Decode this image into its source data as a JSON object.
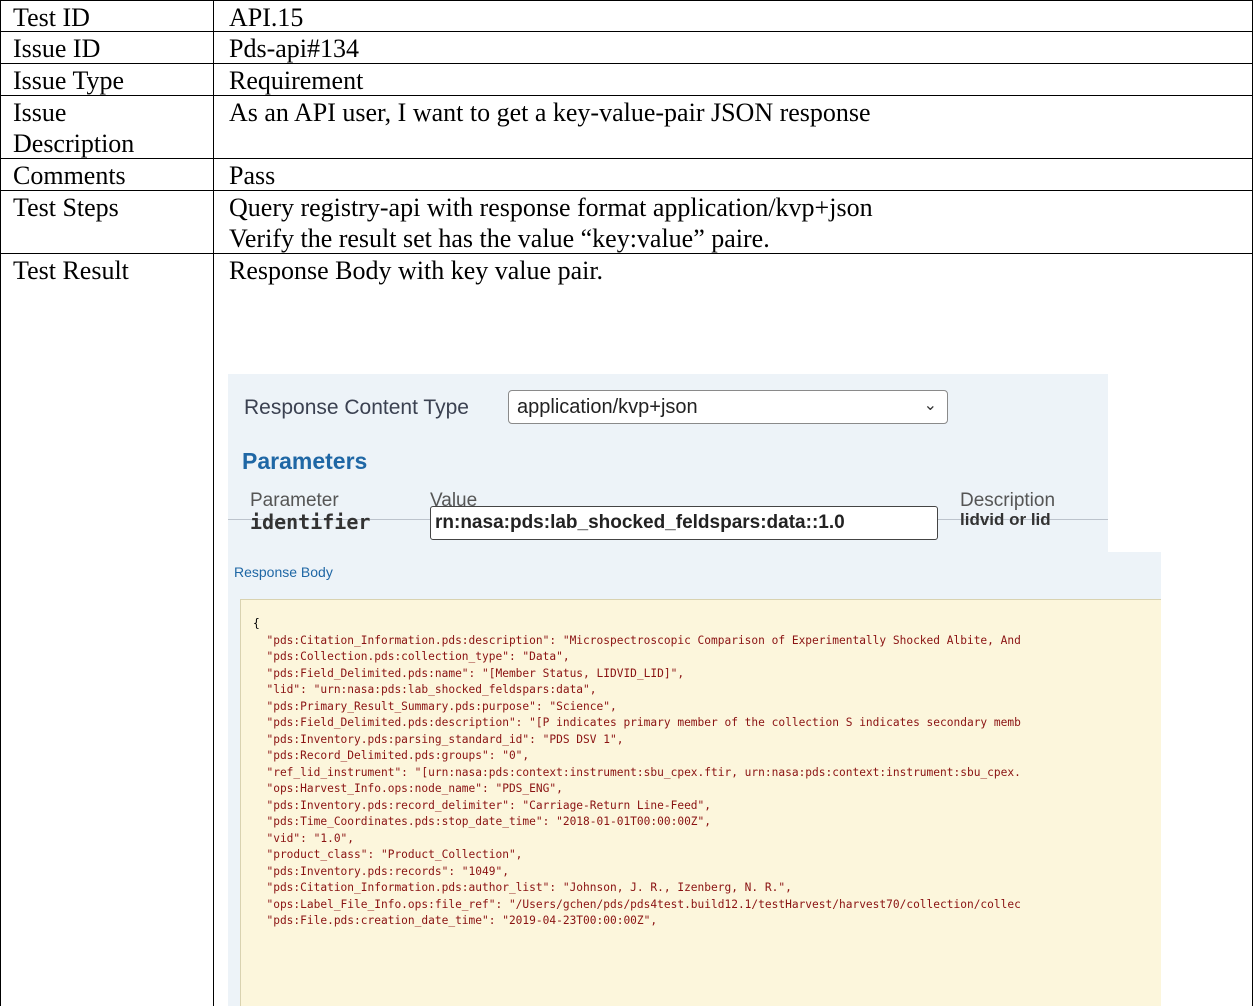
{
  "rows": [
    {
      "label": "Test ID",
      "value": "API.15"
    },
    {
      "label": "Issue ID",
      "value": "Pds-api#134"
    },
    {
      "label": "Issue Type",
      "value": "Requirement"
    },
    {
      "label_lines": [
        "Issue",
        "Description"
      ],
      "value": "As an API user, I want to get a key-value-pair JSON response"
    },
    {
      "label": "Comments",
      "value": "Pass"
    },
    {
      "label": "Test Steps",
      "value_lines": [
        "Query registry-api with response format application/kvp+json",
        "Verify the result set has the value “key:value” paire."
      ]
    },
    {
      "label": "Test Result",
      "value": "Response Body with key value pair."
    }
  ],
  "screenshot": {
    "content_type_label": "Response Content Type",
    "content_type_value": "application/kvp+json",
    "chevron_icon": "chevron-down-icon",
    "parameters_heading": "Parameters",
    "columns": {
      "parameter": "Parameter",
      "value": "Value",
      "description": "Description"
    },
    "param": {
      "name": "identifier",
      "value": "rn:nasa:pds:lab_shocked_feldspars:data::1.0",
      "description": "lidvid or lid"
    },
    "response_body_label": "Response Body",
    "json_lines": [
      "{",
      "  \"pds:Citation_Information.pds:description\": \"Microspectroscopic Comparison of Experimentally Shocked Albite, And",
      "  \"pds:Collection.pds:collection_type\": \"Data\",",
      "  \"pds:Field_Delimited.pds:name\": \"[Member Status, LIDVID_LID]\",",
      "  \"lid\": \"urn:nasa:pds:lab_shocked_feldspars:data\",",
      "  \"pds:Primary_Result_Summary.pds:purpose\": \"Science\",",
      "  \"pds:Field_Delimited.pds:description\": \"[P indicates primary member of the collection S indicates secondary memb",
      "  \"pds:Inventory.pds:parsing_standard_id\": \"PDS DSV 1\",",
      "  \"pds:Record_Delimited.pds:groups\": \"0\",",
      "  \"ref_lid_instrument\": \"[urn:nasa:pds:context:instrument:sbu_cpex.ftir, urn:nasa:pds:context:instrument:sbu_cpex.",
      "  \"ops:Harvest_Info.ops:node_name\": \"PDS_ENG\",",
      "  \"pds:Inventory.pds:record_delimiter\": \"Carriage-Return Line-Feed\",",
      "  \"pds:Time_Coordinates.pds:stop_date_time\": \"2018-01-01T00:00:00Z\",",
      "  \"vid\": \"1.0\",",
      "  \"product_class\": \"Product_Collection\",",
      "  \"pds:Inventory.pds:records\": \"1049\",",
      "  \"pds:Citation_Information.pds:author_list\": \"Johnson, J. R., Izenberg, N. R.\",",
      "  \"ops:Label_File_Info.ops:file_ref\": \"/Users/gchen/pds/pds4test.build12.1/testHarvest/harvest70/collection/collec",
      "  \"pds:File.pds:creation_date_time\": \"2019-04-23T00:00:00Z\","
    ]
  }
}
